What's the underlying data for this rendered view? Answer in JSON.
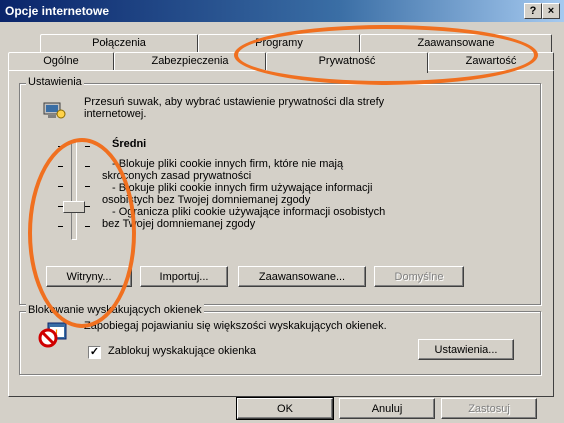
{
  "window": {
    "title": "Opcje internetowe",
    "help_button": "?",
    "close_button": "×"
  },
  "tabs": {
    "row1": [
      "Połączenia",
      "Programy",
      "Zaawansowane"
    ],
    "row2": [
      "Ogólne",
      "Zabezpieczenia",
      "Prywatność",
      "Zawartość"
    ],
    "active": "Prywatność"
  },
  "settings": {
    "group_label": "Ustawienia",
    "intro_line1": "Przesuń suwak, aby wybrać ustawienie prywatności dla strefy",
    "intro_line2": "internetowej.",
    "level_title": "Średni",
    "desc": [
      "- Blokuje pliki cookie innych firm, które nie mają",
      "skróconych zasad prywatności",
      "- Blokuje pliki cookie innych firm używające informacji",
      "osobistych bez Twojej domniemanej zgody",
      "- Ogranicza pliki cookie używające informacji osobistych",
      "bez Twojej domniemanej zgody"
    ],
    "buttons": {
      "sites": "Witryny...",
      "import": "Importuj...",
      "advanced": "Zaawansowane...",
      "default": "Domyślne"
    }
  },
  "popup": {
    "group_label": "Blokowanie wyskakujących okienek",
    "description": "Zapobiegaj pojawianiu się większości wyskakujących okienek.",
    "checkbox_label": "Zablokuj wyskakujące okienka",
    "checkbox_checked": true,
    "settings_button": "Ustawienia..."
  },
  "footer": {
    "ok": "OK",
    "cancel": "Anuluj",
    "apply": "Zastosuj"
  },
  "colors": {
    "highlight_circle": "#f07020",
    "titlebar": "#0a246a"
  }
}
